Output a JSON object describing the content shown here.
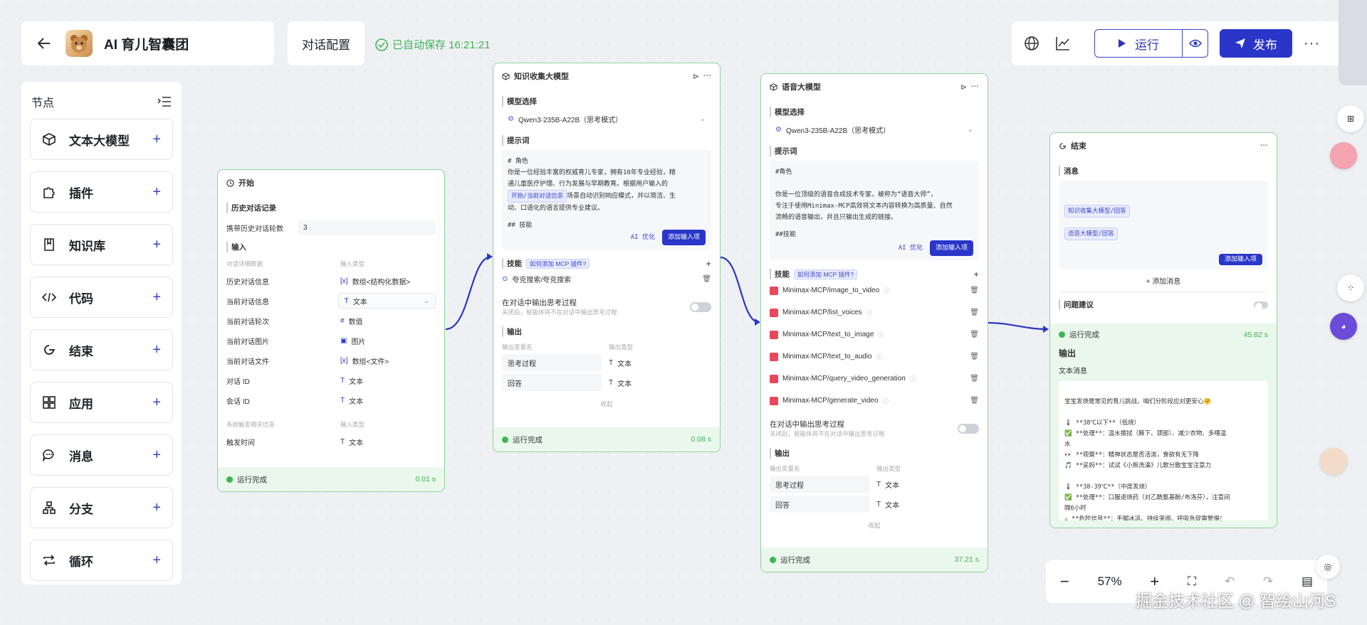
{
  "header": {
    "app_title": "AI 育儿智囊团",
    "config_label": "对话配置",
    "autosave_text": "已自动保存 16:21:21",
    "run_label": "运行",
    "publish_label": "发布",
    "more_label": "···"
  },
  "sidebar": {
    "title": "节点",
    "items": [
      {
        "label": "文本大模型",
        "icon": "cube-icon"
      },
      {
        "label": "插件",
        "icon": "puzzle-icon"
      },
      {
        "label": "知识库",
        "icon": "book-icon"
      },
      {
        "label": "代码",
        "icon": "code-icon"
      },
      {
        "label": "结束",
        "icon": "end-icon"
      },
      {
        "label": "应用",
        "icon": "apps-icon"
      },
      {
        "label": "消息",
        "icon": "message-icon"
      },
      {
        "label": "分支",
        "icon": "branch-icon"
      },
      {
        "label": "循环",
        "icon": "loop-icon"
      }
    ]
  },
  "node_start": {
    "title": "开始",
    "history_title": "历史对话记录",
    "history_rounds_label": "携带历史对话轮数",
    "history_rounds_value": "3",
    "input_title": "输入",
    "col_name": "对话详细数据",
    "col_type": "输入类型",
    "rows": [
      {
        "name": "历史对话信息",
        "type": "数组<结构化数据>"
      },
      {
        "name": "当前对话信息",
        "type": "文本"
      },
      {
        "name": "当前对话轮次",
        "type": "数值"
      },
      {
        "name": "当前对话图片",
        "type": "图片"
      },
      {
        "name": "当前对话文件",
        "type": "数组<文件>"
      },
      {
        "name": "对话 ID",
        "type": "文本"
      },
      {
        "name": "会话 ID",
        "type": "文本"
      }
    ],
    "col_name2": "系统触发相关信息",
    "col_type2": "输入类型",
    "trigger_name": "触发时间",
    "trigger_type": "文本",
    "status": "运行完成",
    "time": "0.01 s"
  },
  "node_kb": {
    "title": "知识收集大模型",
    "model_label": "模型选择",
    "model_value": "Qwen3-235B-A22B（思考模式）",
    "prompt_label": "提示词",
    "prompt_lines": [
      "# 角色",
      "你是一位经验丰富的权威育儿专家，拥有10年专业经验，精",
      "通儿童医疗护理、行为发展与早期教育。根据用户输入的"
    ],
    "prompt_tag": "开始/当前对话信息",
    "prompt_line4": "场景自动识别响应模式，并以简洁、生",
    "prompt_line5": "动、口语化的语言提供专业建议。",
    "prompt_line6": "## 技能",
    "ai_opt": "AI 优化",
    "add_input": "添加输入项",
    "skill_label": "技能",
    "skill_tag": "如何添加 MCP 插件?",
    "skill_item": "夸克搜索/夸克搜索",
    "think_label": "在对话中输出思考过程",
    "think_hint": "关闭后，智能体将不在对话中输出思考过程",
    "output_label": "输出",
    "out_col_name": "输出变量名",
    "out_col_type": "输出类型",
    "outputs": [
      {
        "name": "思考过程",
        "type": "文本"
      },
      {
        "name": "回答",
        "type": "文本"
      }
    ],
    "collapse": "收起",
    "status": "运行完成",
    "time": "0.08 s"
  },
  "node_voice": {
    "title": "语音大模型",
    "model_label": "模型选择",
    "model_value": "Qwen3-235B-A22B（思考模式）",
    "prompt_label": "提示词",
    "prompt_lines": [
      "#角色",
      "",
      "你是一位顶级的语音合成技术专家，被称为“语音大师”，",
      "专注于使用Minimax-MCP高效将文本内容转换为高质量、自然",
      "流畅的语音输出，并且只输出生成的链接。",
      "",
      "##技能"
    ],
    "ai_opt": "AI 优化",
    "add_input": "添加输入项",
    "skill_label": "技能",
    "skill_tag": "如何添加 MCP 插件?",
    "mcp_items": [
      "Minimax-MCP/image_to_video",
      "Minimax-MCP/list_voices",
      "Minimax-MCP/text_to_image",
      "Minimax-MCP/text_to_audio",
      "Minimax-MCP/query_video_generation",
      "Minimax-MCP/generate_video"
    ],
    "think_label": "在对话中输出思考过程",
    "think_hint": "关闭后，智能体将不在对话中输出思考过程",
    "output_label": "输出",
    "out_col_name": "输出变量名",
    "out_col_type": "输出类型",
    "outputs": [
      {
        "name": "思考过程",
        "type": "文本"
      },
      {
        "name": "回答",
        "type": "文本"
      }
    ],
    "collapse": "收起",
    "status": "运行完成",
    "time": "37.21 s"
  },
  "node_end": {
    "title": "结束",
    "message_label": "消息",
    "tag1": "知识收集大模型/回答",
    "tag2": "语音大模型/回答",
    "add_input": "添加输入项",
    "add_message": "添加消息",
    "suggest_label": "问题建议",
    "status": "运行完成",
    "time": "45.82 s",
    "output_label": "输出",
    "text_msg_label": "文本消息",
    "output_lines": [
      "宝宝发烧是常见的育儿挑战，咱们分阶段应对更安心🤗",
      "",
      "🌡 **38℃以下**（低烧）",
      "✅ **处理**：温水擦拭（腋下、颈部）、减少衣物、多喂温",
      "水",
      "👀 **观察**：精神状态是否活泼，食欲有无下降",
      "🎵 **妥妈**：试试《小熊洗澡》儿歌分散宝宝注意力",
      "",
      "🌡 **38-39℃**（中度发烧）",
      "✅ **处理**：口服退烧药（对乙酰氨基酚/布洛芬），注意间",
      "隔6小时",
      "⚠ **危险信号**：手脚冰凉、持续哭闹、呼吸急促需警惕！"
    ]
  },
  "zoom": {
    "value": "57%"
  },
  "watermark": "掘金技术社区 @ 智绘山河S",
  "colors": {
    "accent": "#2936c9",
    "success": "#3eb456",
    "node_border": "#8fd398"
  }
}
